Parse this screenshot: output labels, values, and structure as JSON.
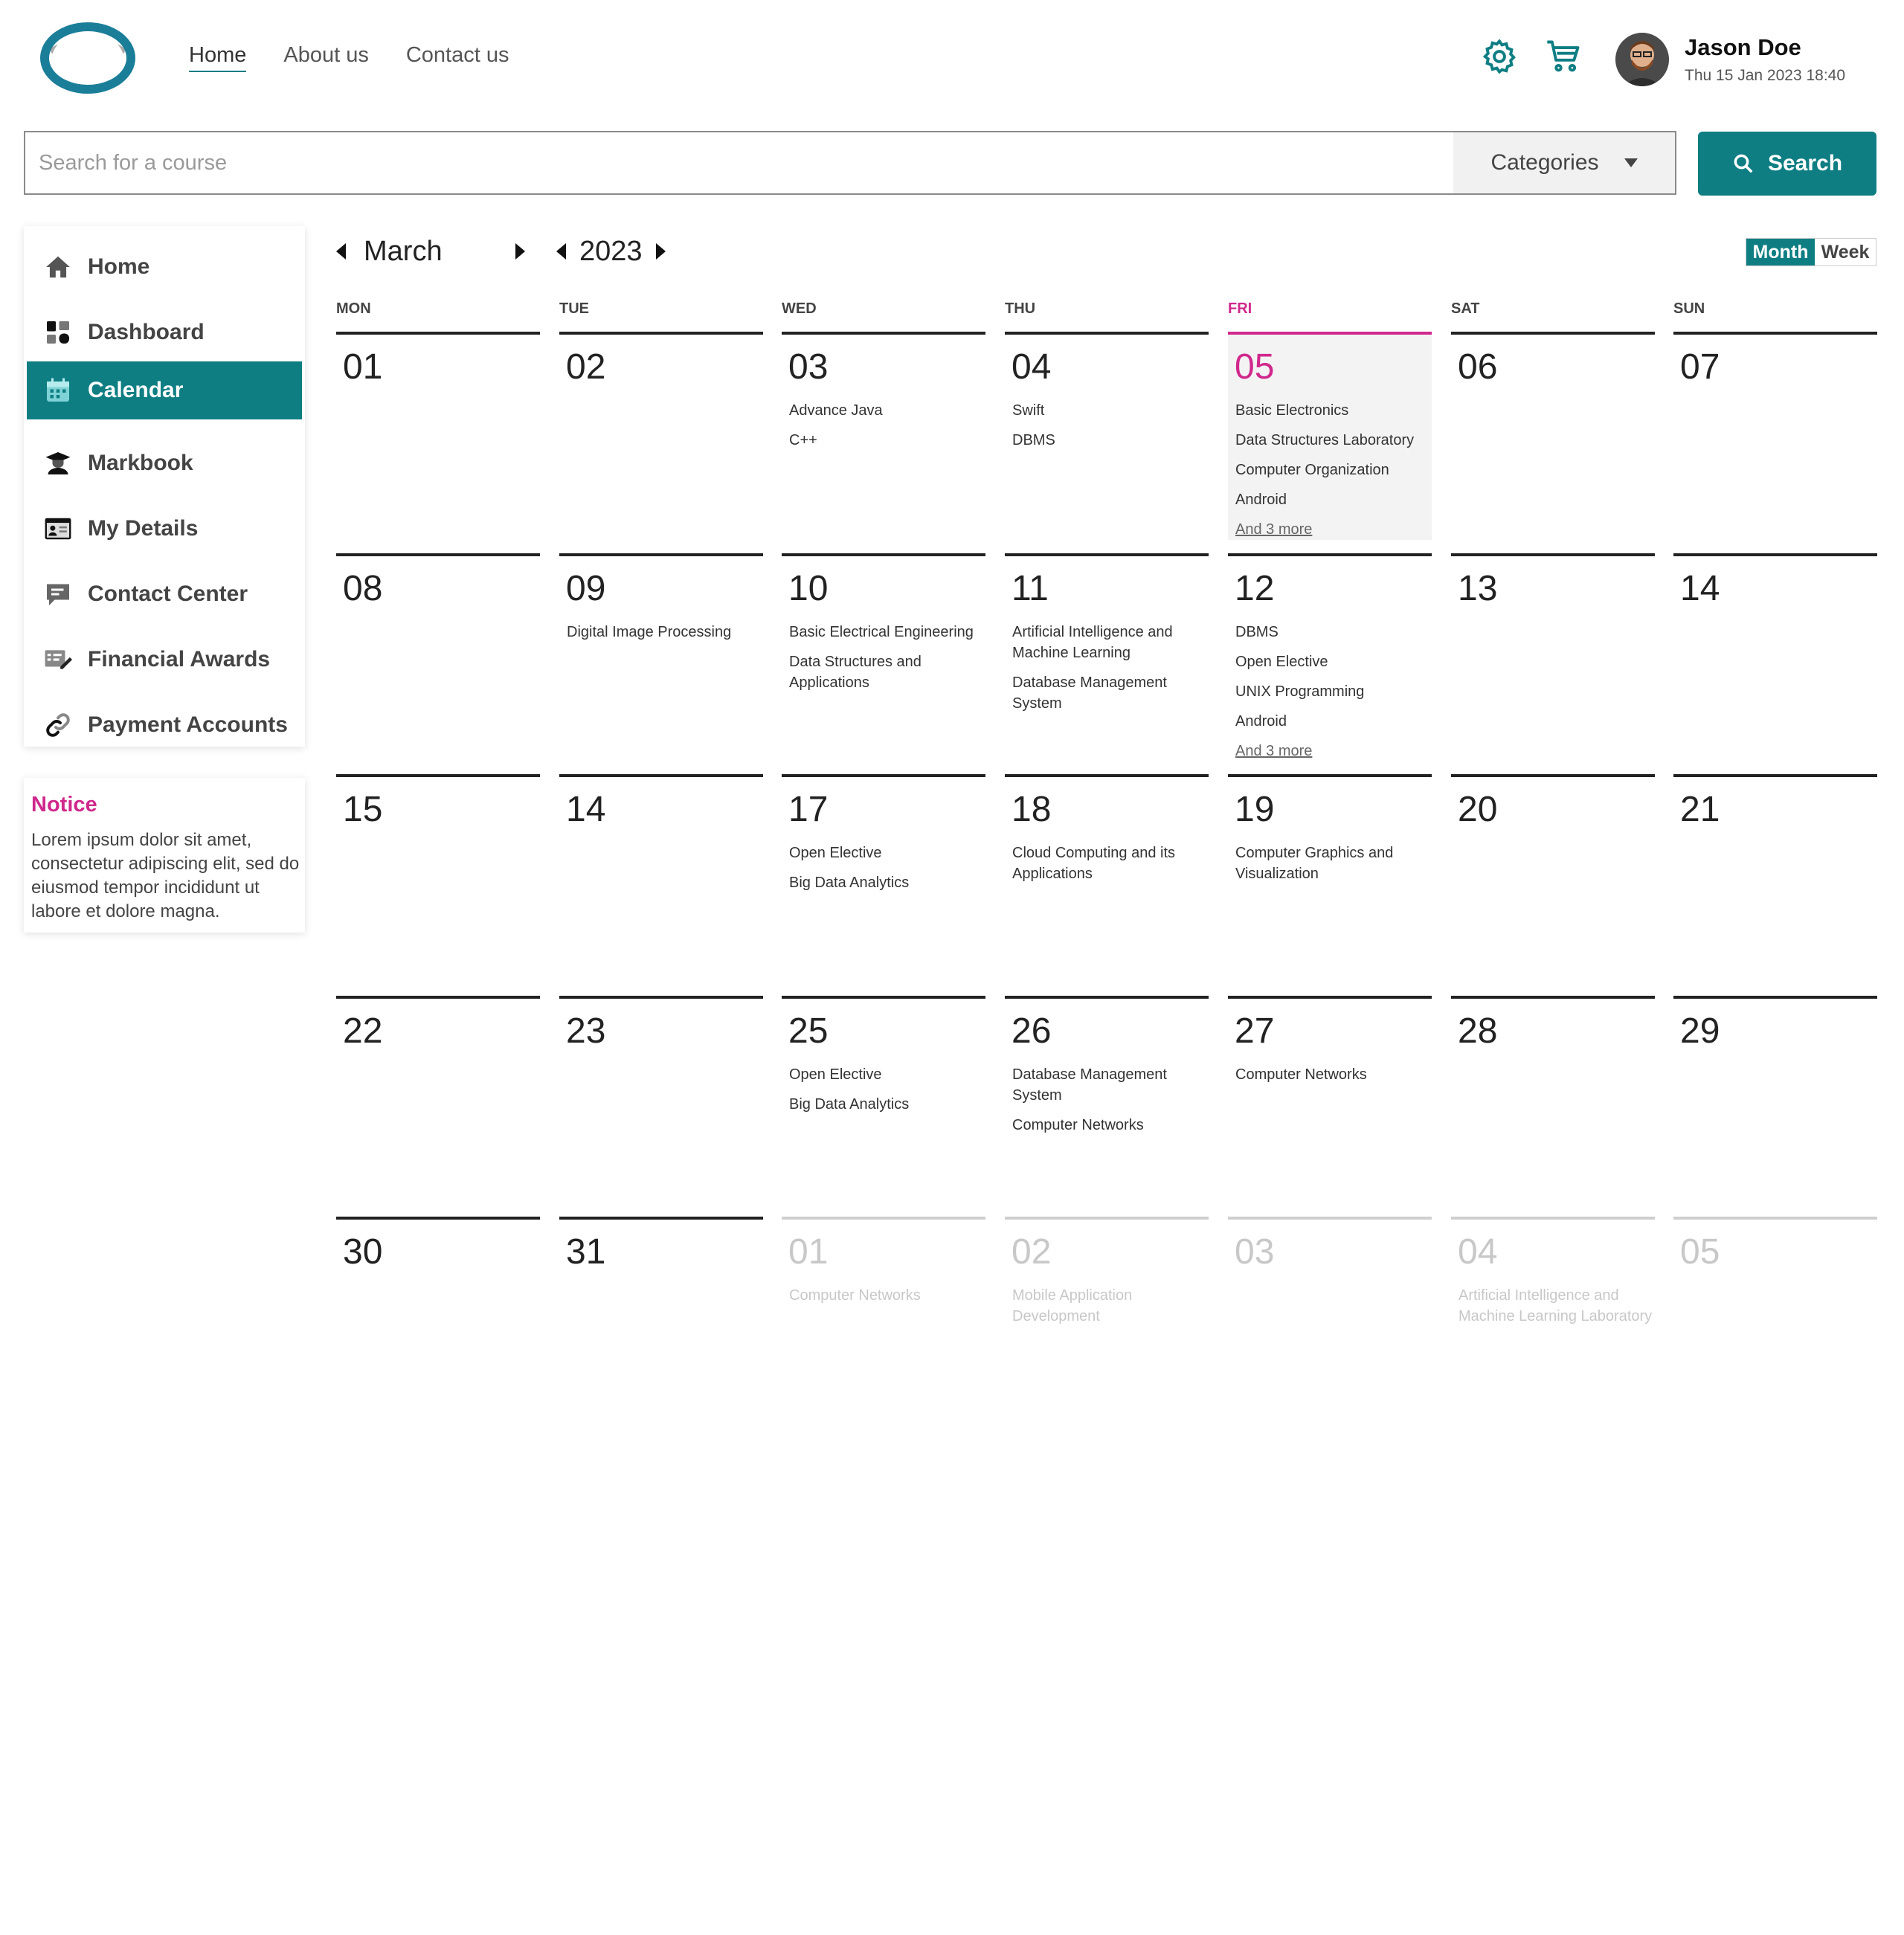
{
  "header": {
    "nav": [
      "Home",
      "About us",
      "Contact us"
    ],
    "user_name": "Jason Doe",
    "user_datetime": "Thu 15 Jan 2023 18:40",
    "icons": [
      "gear-icon",
      "cart-icon"
    ]
  },
  "search": {
    "placeholder": "Search for a course",
    "categories_label": "Categories",
    "button_label": "Search"
  },
  "sidebar": {
    "items": [
      {
        "label": "Home",
        "icon": "home-icon"
      },
      {
        "label": "Dashboard",
        "icon": "dashboard-icon"
      },
      {
        "label": "Calendar",
        "icon": "calendar-icon",
        "active": true
      },
      {
        "label": "Markbook",
        "icon": "graduate-icon"
      },
      {
        "label": "My Details",
        "icon": "id-card-icon"
      },
      {
        "label": "Contact Center",
        "icon": "chat-icon"
      },
      {
        "label": "Financial Awards",
        "icon": "award-edit-icon"
      },
      {
        "label": "Payment Accounts",
        "icon": "link-icon"
      }
    ]
  },
  "notice": {
    "title": "Notice",
    "text": "Lorem ipsum dolor sit amet, consectetur adipiscing elit, sed do eiusmod tempor incididunt ut labore et dolore magna."
  },
  "calendar": {
    "month": "March",
    "year": "2023",
    "view": {
      "month": "Month",
      "week": "Week"
    },
    "weekdays": [
      "MON",
      "TUE",
      "WED",
      "THU",
      "FRI",
      "SAT",
      "SUN"
    ],
    "highlight_weekday": 4,
    "weeks": [
      [
        {
          "day": "01",
          "events": []
        },
        {
          "day": "02",
          "events": []
        },
        {
          "day": "03",
          "events": [
            "Advance Java",
            "C++"
          ]
        },
        {
          "day": "04",
          "events": [
            "Swift",
            "DBMS"
          ]
        },
        {
          "day": "05",
          "events": [
            "Basic Electronics",
            "Data Structures Laboratory",
            "Computer Organization",
            "Android"
          ],
          "more": "And 3 more",
          "highlight": true
        },
        {
          "day": "06",
          "events": []
        },
        {
          "day": "07",
          "events": []
        }
      ],
      [
        {
          "day": "08",
          "events": []
        },
        {
          "day": "09",
          "events": [
            "Digital Image Processing"
          ]
        },
        {
          "day": "10",
          "events": [
            "Basic Electrical Engineering",
            "Data Structures and Applications"
          ]
        },
        {
          "day": "11",
          "events": [
            "Artificial Intelligence and Machine Learning",
            "Database Management System"
          ]
        },
        {
          "day": "12",
          "events": [
            "DBMS",
            "Open Elective",
            "UNIX Programming",
            "Android"
          ],
          "more": "And 3 more"
        },
        {
          "day": "13",
          "events": []
        },
        {
          "day": "14",
          "events": []
        }
      ],
      [
        {
          "day": "15",
          "events": []
        },
        {
          "day": "14",
          "events": []
        },
        {
          "day": "17",
          "events": [
            "Open Elective",
            "Big Data Analytics"
          ]
        },
        {
          "day": "18",
          "events": [
            "Cloud Computing and its Applications"
          ]
        },
        {
          "day": "19",
          "events": [
            "Computer Graphics and Visualization"
          ]
        },
        {
          "day": "20",
          "events": []
        },
        {
          "day": "21",
          "events": []
        }
      ],
      [
        {
          "day": "22",
          "events": []
        },
        {
          "day": "23",
          "events": []
        },
        {
          "day": "25",
          "events": [
            "Open Elective",
            "Big Data Analytics"
          ]
        },
        {
          "day": "26",
          "events": [
            "Database Management System",
            "Computer Networks"
          ]
        },
        {
          "day": "27",
          "events": [
            "Computer Networks"
          ]
        },
        {
          "day": "28",
          "events": []
        },
        {
          "day": "29",
          "events": []
        }
      ],
      [
        {
          "day": "30",
          "events": []
        },
        {
          "day": "31",
          "events": []
        },
        {
          "day": "01",
          "events": [
            "Computer Networks"
          ],
          "muted": true
        },
        {
          "day": "02",
          "events": [
            "Mobile Application Development"
          ],
          "muted": true
        },
        {
          "day": "03",
          "events": [],
          "muted": true
        },
        {
          "day": "04",
          "events": [
            "Artificial Intelligence and Machine Learning Laboratory"
          ],
          "muted": true
        },
        {
          "day": "05",
          "events": [],
          "muted": true
        }
      ]
    ]
  },
  "colors": {
    "accent": "#0e7e83",
    "highlight": "#d0288c"
  }
}
